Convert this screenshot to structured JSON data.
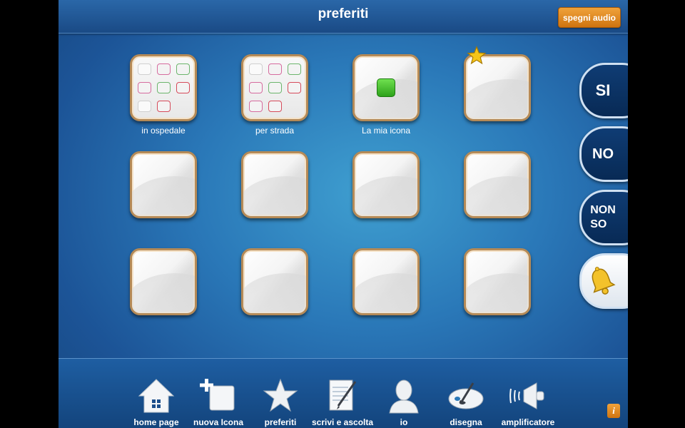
{
  "header": {
    "title": "preferiti",
    "audio_button": "spegni audio"
  },
  "grid": {
    "tiles": [
      {
        "label": "in ospedale",
        "kind": "folder"
      },
      {
        "label": "per strada",
        "kind": "folder"
      },
      {
        "label": "La mia icona",
        "kind": "custom-icon",
        "favorite": true
      },
      {
        "label": "",
        "kind": "empty"
      },
      {
        "label": "",
        "kind": "empty"
      },
      {
        "label": "",
        "kind": "empty"
      },
      {
        "label": "",
        "kind": "empty"
      },
      {
        "label": "",
        "kind": "empty"
      },
      {
        "label": "",
        "kind": "empty"
      },
      {
        "label": "",
        "kind": "empty"
      },
      {
        "label": "",
        "kind": "empty"
      },
      {
        "label": "",
        "kind": "empty"
      }
    ]
  },
  "side_buttons": {
    "yes": "SI",
    "no": "NO",
    "dont_know_line1": "NON",
    "dont_know_line2": "SO",
    "bell_icon": "bell-icon"
  },
  "dock": {
    "items": [
      {
        "label": "home page",
        "icon": "home-icon"
      },
      {
        "label": "nuova Icona",
        "icon": "new-icon-icon"
      },
      {
        "label": "preferiti",
        "icon": "star-icon"
      },
      {
        "label": "scrivi e ascolta",
        "icon": "pen-paper-icon"
      },
      {
        "label": "io",
        "icon": "person-icon"
      },
      {
        "label": "disegna",
        "icon": "palette-icon"
      },
      {
        "label": "amplificatore",
        "icon": "megaphone-icon"
      }
    ]
  },
  "info_button": "i",
  "colors": {
    "accent_orange": "#e08a22",
    "background_blue": "#2a78b8",
    "dark_navy": "#0a2f5e",
    "tile_border": "#b58a57"
  }
}
